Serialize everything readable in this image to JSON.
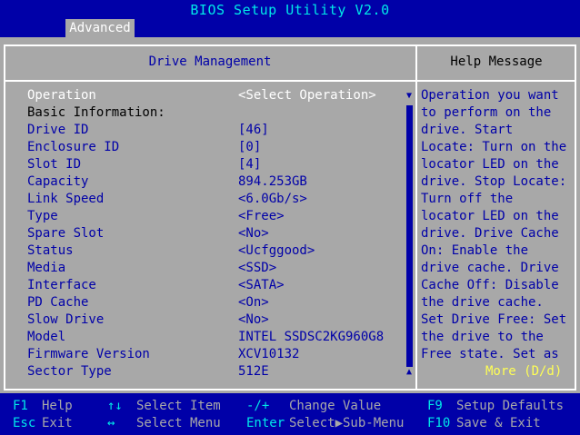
{
  "app": {
    "title": "BIOS Setup Utility V2.0"
  },
  "tabs": [
    {
      "label": "Advanced"
    }
  ],
  "panel": {
    "left_header": "Drive Management",
    "right_header": "Help Message"
  },
  "rows": [
    {
      "label": "Operation",
      "value": "<Select Operation>"
    },
    {
      "label": "Basic Information:",
      "value": ""
    },
    {
      "label": "Drive ID",
      "value": "[46]"
    },
    {
      "label": "Enclosure ID",
      "value": "[0]"
    },
    {
      "label": "Slot ID",
      "value": "[4]"
    },
    {
      "label": "Capacity",
      "value": "894.253GB"
    },
    {
      "label": "Link Speed",
      "value": "<6.0Gb/s>"
    },
    {
      "label": "Type",
      "value": "<Free>"
    },
    {
      "label": "Spare Slot",
      "value": "<No>"
    },
    {
      "label": "Status",
      "value": "<Ucfggood>"
    },
    {
      "label": "Media",
      "value": "<SSD>"
    },
    {
      "label": "Interface",
      "value": "<SATA>"
    },
    {
      "label": "PD Cache",
      "value": "<On>"
    },
    {
      "label": "Slow Drive",
      "value": "<No>"
    },
    {
      "label": "Model",
      "value": "INTEL SSDSC2KG960G8"
    },
    {
      "label": "Firmware Version",
      "value": "XCV10132"
    },
    {
      "label": "Sector Type",
      "value": "512E"
    }
  ],
  "help": {
    "lines": [
      "Operation you want",
      "to perform on the",
      "drive. Start",
      "Locate: Turn on the",
      "locator LED on the",
      "drive. Stop Locate:",
      "Turn off the",
      "locator LED on the",
      "drive. Drive Cache",
      "On: Enable the",
      "drive cache. Drive",
      "Cache Off: Disable",
      "the drive cache.",
      "Set Drive Free: Set",
      "the drive to the",
      "Free state. Set as"
    ],
    "more": "More (D/d)"
  },
  "footer": {
    "f1_key": "F1",
    "f1_desc": "Help",
    "esc_key": "Esc",
    "esc_desc": "Exit",
    "updown_key": "↑↓",
    "updown_desc": "Select Item",
    "leftright_key": "↔",
    "leftright_desc": "Select Menu",
    "plusminus_key": "-/+",
    "plusminus_desc": "Change Value",
    "enter_key": "Enter",
    "enter_desc": "Select▶Sub-Menu",
    "f9_key": "F9",
    "f9_desc": "Setup Defaults",
    "f10_key": "F10",
    "f10_desc": "Save & Exit"
  },
  "colors": {
    "background": "#0000a8",
    "panel": "#a8a8a8",
    "title": "#00e8e8",
    "highlight": "#ffffff",
    "more": "#ffff54"
  }
}
